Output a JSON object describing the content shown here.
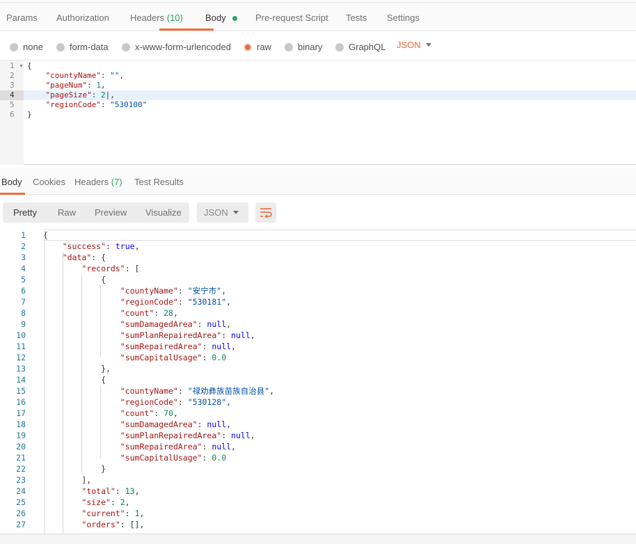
{
  "request_tabs": [
    {
      "label": "Params"
    },
    {
      "label": "Authorization"
    },
    {
      "label": "Headers",
      "count": "(10)"
    },
    {
      "label": "Body"
    },
    {
      "label": "Pre-request Script"
    },
    {
      "label": "Tests"
    },
    {
      "label": "Settings"
    }
  ],
  "body_modes": [
    {
      "label": "none",
      "selected": false
    },
    {
      "label": "form-data",
      "selected": false
    },
    {
      "label": "x-www-form-urlencoded",
      "selected": false
    },
    {
      "label": "raw",
      "selected": true
    },
    {
      "label": "binary",
      "selected": false
    },
    {
      "label": "GraphQL",
      "selected": false
    }
  ],
  "raw_format": "JSON",
  "accent": "#f26b3a",
  "request_body": [
    [
      [
        "p",
        "{"
      ]
    ],
    [
      [
        "p",
        "    "
      ],
      [
        "k",
        "\"countyName\""
      ],
      [
        "p",
        ": "
      ],
      [
        "s",
        "\"\""
      ],
      [
        "p",
        ","
      ]
    ],
    [
      [
        "p",
        "    "
      ],
      [
        "k",
        "\"pageNum\""
      ],
      [
        "p",
        ": "
      ],
      [
        "n",
        "1"
      ],
      [
        "p",
        ","
      ]
    ],
    [
      [
        "p",
        "    "
      ],
      [
        "k",
        "\"pageSize\""
      ],
      [
        "p",
        ": "
      ],
      [
        "n",
        "2"
      ],
      [
        "p",
        "|,"
      ]
    ],
    [
      [
        "p",
        "    "
      ],
      [
        "k",
        "\"regionCode\""
      ],
      [
        "p",
        ": "
      ],
      [
        "s",
        "\"530100\""
      ]
    ],
    [
      [
        "p",
        "}"
      ]
    ]
  ],
  "response_tabs": [
    {
      "label": "Body"
    },
    {
      "label": "Cookies"
    },
    {
      "label": "Headers",
      "count": "(7)"
    },
    {
      "label": "Test Results"
    }
  ],
  "view_modes": [
    {
      "label": "Pretty"
    },
    {
      "label": "Raw"
    },
    {
      "label": "Preview"
    },
    {
      "label": "Visualize"
    }
  ],
  "response_format": "JSON",
  "wrap_icon": "wrap-lines-icon",
  "response_body": [
    [
      [
        "p",
        "{"
      ]
    ],
    [
      [
        "p",
        "    "
      ],
      [
        "k",
        "\"success\""
      ],
      [
        "p",
        ": "
      ],
      [
        "b",
        "true"
      ],
      [
        "p",
        ","
      ]
    ],
    [
      [
        "p",
        "    "
      ],
      [
        "k",
        "\"data\""
      ],
      [
        "p",
        ": {"
      ]
    ],
    [
      [
        "p",
        "        "
      ],
      [
        "k",
        "\"records\""
      ],
      [
        "p",
        ": ["
      ]
    ],
    [
      [
        "p",
        "            {"
      ]
    ],
    [
      [
        "p",
        "                "
      ],
      [
        "k",
        "\"countyName\""
      ],
      [
        "p",
        ": "
      ],
      [
        "s",
        "\"安宁市\""
      ],
      [
        "p",
        ","
      ]
    ],
    [
      [
        "p",
        "                "
      ],
      [
        "k",
        "\"regionCode\""
      ],
      [
        "p",
        ": "
      ],
      [
        "s",
        "\"530181\""
      ],
      [
        "p",
        ","
      ]
    ],
    [
      [
        "p",
        "                "
      ],
      [
        "k",
        "\"count\""
      ],
      [
        "p",
        ": "
      ],
      [
        "n",
        "28"
      ],
      [
        "p",
        ","
      ]
    ],
    [
      [
        "p",
        "                "
      ],
      [
        "k",
        "\"sumDamagedArea\""
      ],
      [
        "p",
        ": "
      ],
      [
        "b",
        "null"
      ],
      [
        "p",
        ","
      ]
    ],
    [
      [
        "p",
        "                "
      ],
      [
        "k",
        "\"sumPlanRepairedArea\""
      ],
      [
        "p",
        ": "
      ],
      [
        "b",
        "null"
      ],
      [
        "p",
        ","
      ]
    ],
    [
      [
        "p",
        "                "
      ],
      [
        "k",
        "\"sumRepairedArea\""
      ],
      [
        "p",
        ": "
      ],
      [
        "b",
        "null"
      ],
      [
        "p",
        ","
      ]
    ],
    [
      [
        "p",
        "                "
      ],
      [
        "k",
        "\"sumCapitalUsage\""
      ],
      [
        "p",
        ": "
      ],
      [
        "n",
        "0.0"
      ]
    ],
    [
      [
        "p",
        "            },"
      ]
    ],
    [
      [
        "p",
        "            {"
      ]
    ],
    [
      [
        "p",
        "                "
      ],
      [
        "k",
        "\"countyName\""
      ],
      [
        "p",
        ": "
      ],
      [
        "s",
        "\"禄劝彝族苗族自治县\""
      ],
      [
        "p",
        ","
      ]
    ],
    [
      [
        "p",
        "                "
      ],
      [
        "k",
        "\"regionCode\""
      ],
      [
        "p",
        ": "
      ],
      [
        "s",
        "\"530128\""
      ],
      [
        "p",
        ","
      ]
    ],
    [
      [
        "p",
        "                "
      ],
      [
        "k",
        "\"count\""
      ],
      [
        "p",
        ": "
      ],
      [
        "n",
        "70"
      ],
      [
        "p",
        ","
      ]
    ],
    [
      [
        "p",
        "                "
      ],
      [
        "k",
        "\"sumDamagedArea\""
      ],
      [
        "p",
        ": "
      ],
      [
        "b",
        "null"
      ],
      [
        "p",
        ","
      ]
    ],
    [
      [
        "p",
        "                "
      ],
      [
        "k",
        "\"sumPlanRepairedArea\""
      ],
      [
        "p",
        ": "
      ],
      [
        "b",
        "null"
      ],
      [
        "p",
        ","
      ]
    ],
    [
      [
        "p",
        "                "
      ],
      [
        "k",
        "\"sumRepairedArea\""
      ],
      [
        "p",
        ": "
      ],
      [
        "b",
        "null"
      ],
      [
        "p",
        ","
      ]
    ],
    [
      [
        "p",
        "                "
      ],
      [
        "k",
        "\"sumCapitalUsage\""
      ],
      [
        "p",
        ": "
      ],
      [
        "n",
        "0.0"
      ]
    ],
    [
      [
        "p",
        "            }"
      ]
    ],
    [
      [
        "p",
        "        ],"
      ]
    ],
    [
      [
        "p",
        "        "
      ],
      [
        "k",
        "\"total\""
      ],
      [
        "p",
        ": "
      ],
      [
        "n",
        "13"
      ],
      [
        "p",
        ","
      ]
    ],
    [
      [
        "p",
        "        "
      ],
      [
        "k",
        "\"size\""
      ],
      [
        "p",
        ": "
      ],
      [
        "n",
        "2"
      ],
      [
        "p",
        ","
      ]
    ],
    [
      [
        "p",
        "        "
      ],
      [
        "k",
        "\"current\""
      ],
      [
        "p",
        ": "
      ],
      [
        "n",
        "1"
      ],
      [
        "p",
        ","
      ]
    ],
    [
      [
        "p",
        "        "
      ],
      [
        "k",
        "\"orders\""
      ],
      [
        "p",
        ": [],"
      ]
    ]
  ]
}
